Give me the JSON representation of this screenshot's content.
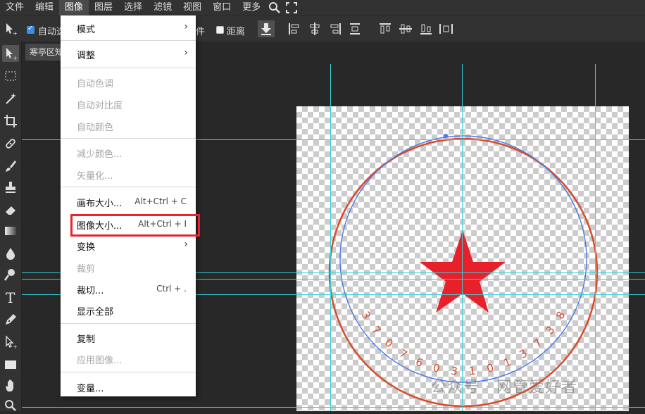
{
  "menubar": {
    "items": [
      "文件",
      "编辑",
      "图像",
      "图层",
      "选择",
      "滤镜",
      "视图",
      "窗口",
      "更多"
    ],
    "active_index": 2,
    "search_icon": "search-icon",
    "fullscreen_icon": "fullscreen-icon"
  },
  "options": {
    "auto_select_label": "自动选",
    "auto_select_checked": true,
    "transform_fragment": "件",
    "distance_label": "距离",
    "distance_checked": false
  },
  "doc_tab": {
    "title": "寒亭区知"
  },
  "image_menu": {
    "items": [
      {
        "label": "模式",
        "submenu": true,
        "disabled": false
      },
      {
        "label": "调整",
        "submenu": true,
        "disabled": false
      },
      {
        "label": "自动色调",
        "disabled": true
      },
      {
        "label": "自动对比度",
        "disabled": true
      },
      {
        "label": "自动颜色",
        "disabled": true
      },
      {
        "label": "减少颜色...",
        "disabled": true
      },
      {
        "label": "矢量化...",
        "disabled": true
      },
      {
        "label": "画布大小...",
        "shortcut": "Alt+Ctrl + C",
        "disabled": false
      },
      {
        "label": "图像大小...",
        "shortcut": "Alt+Ctrl + I",
        "disabled": false,
        "highlighted": true
      },
      {
        "label": "变换",
        "submenu": true,
        "disabled": false
      },
      {
        "label": "裁剪",
        "disabled": true
      },
      {
        "label": "裁切...",
        "shortcut": "Ctrl + .",
        "disabled": false
      },
      {
        "label": "显示全部",
        "disabled": false
      },
      {
        "label": "复制",
        "disabled": false
      },
      {
        "label": "应用图像...",
        "disabled": true
      },
      {
        "label": "变量...",
        "disabled": false
      }
    ]
  },
  "stamp": {
    "digits": [
      "3",
      "7",
      "0",
      "7",
      "6",
      "0",
      "3",
      "1",
      "0",
      "1",
      "3",
      "7",
      "3",
      "8"
    ],
    "circle_color": "#d94a2a",
    "path_color": "#4a78e8",
    "star_color": "#e8202a"
  },
  "watermark": "公众号 · 网管爱好者",
  "colors": {
    "guide": "#34d1d9",
    "highlight_box": "#e8252c",
    "accent_checkbox": "#3a8ee6"
  }
}
